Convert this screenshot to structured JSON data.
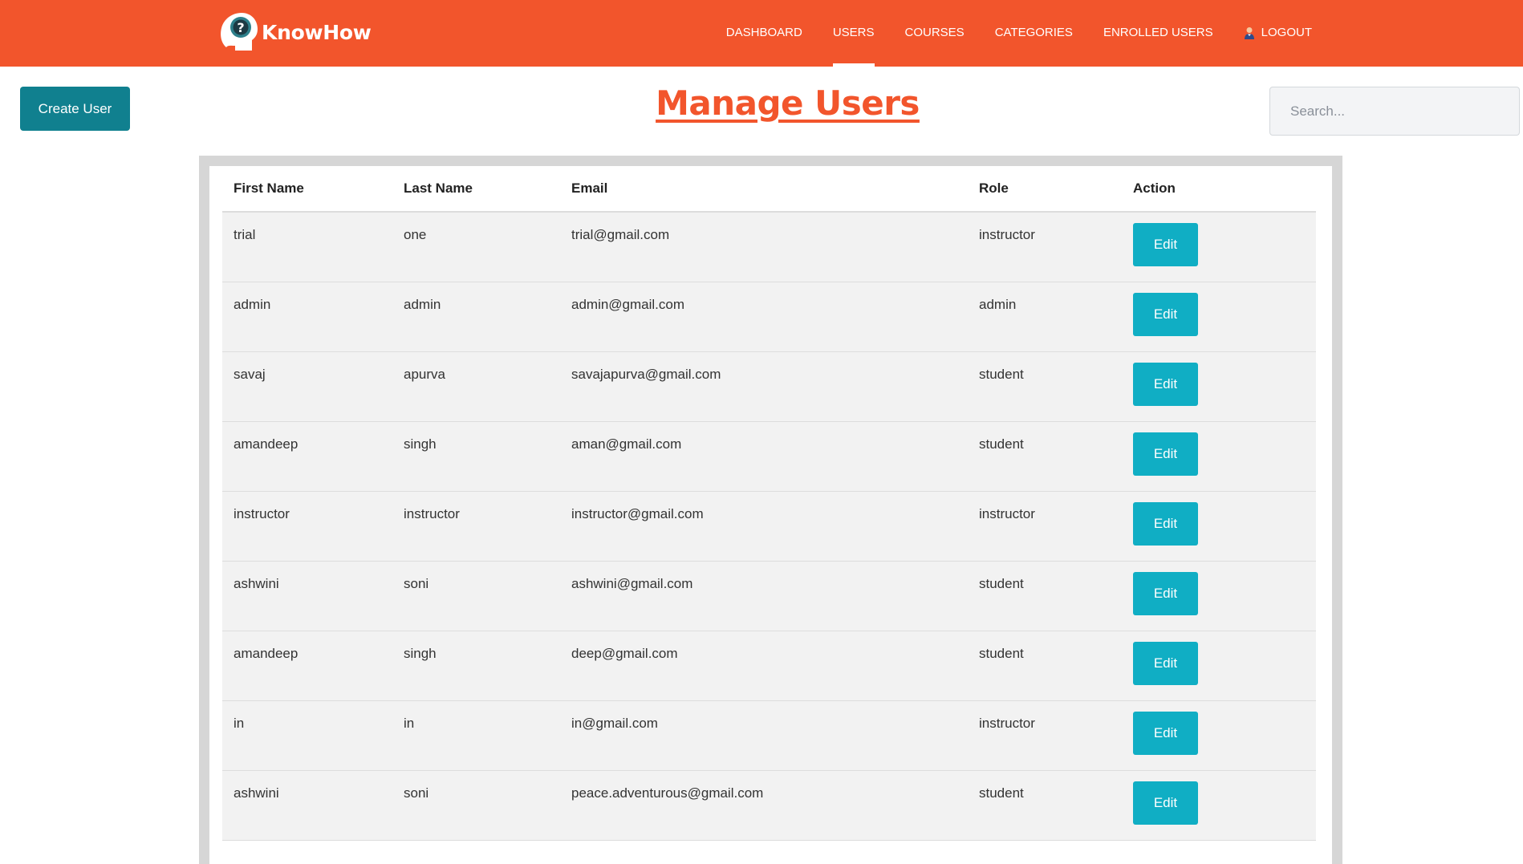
{
  "header": {
    "brand_name": "KnowHow",
    "nav": [
      {
        "label": "DASHBOARD"
      },
      {
        "label": "USERS"
      },
      {
        "label": "COURSES"
      },
      {
        "label": "CATEGORIES"
      },
      {
        "label": "ENROLLED USERS"
      }
    ],
    "logout_label": "LOGOUT",
    "active_nav": "USERS",
    "colors": {
      "primary": "#f2552c",
      "nav_text": "#ffffff"
    }
  },
  "toolbar": {
    "create_label": "Create User",
    "search_placeholder": "Search...",
    "create_color": "#10808f"
  },
  "page": {
    "title": "Manage Users"
  },
  "table": {
    "columns": [
      "First Name",
      "Last Name",
      "Email",
      "Role",
      "Action"
    ],
    "edit_label": "Edit",
    "edit_color": "#10aec4",
    "rows": [
      {
        "first": "trial",
        "last": "one",
        "email": "trial@gmail.com",
        "role": "instructor"
      },
      {
        "first": "admin",
        "last": "admin",
        "email": "admin@gmail.com",
        "role": "admin"
      },
      {
        "first": "savaj",
        "last": "apurva",
        "email": "savajapurva@gmail.com",
        "role": "student"
      },
      {
        "first": "amandeep",
        "last": "singh",
        "email": "aman@gmail.com",
        "role": "student"
      },
      {
        "first": "instructor",
        "last": "instructor",
        "email": "instructor@gmail.com",
        "role": "instructor"
      },
      {
        "first": "ashwini",
        "last": "soni",
        "email": "ashwini@gmail.com",
        "role": "student"
      },
      {
        "first": "amandeep",
        "last": "singh",
        "email": "deep@gmail.com",
        "role": "student"
      },
      {
        "first": "in",
        "last": "in",
        "email": "in@gmail.com",
        "role": "instructor"
      },
      {
        "first": "ashwini",
        "last": "soni",
        "email": "peace.adventurous@gmail.com",
        "role": "student"
      }
    ]
  }
}
